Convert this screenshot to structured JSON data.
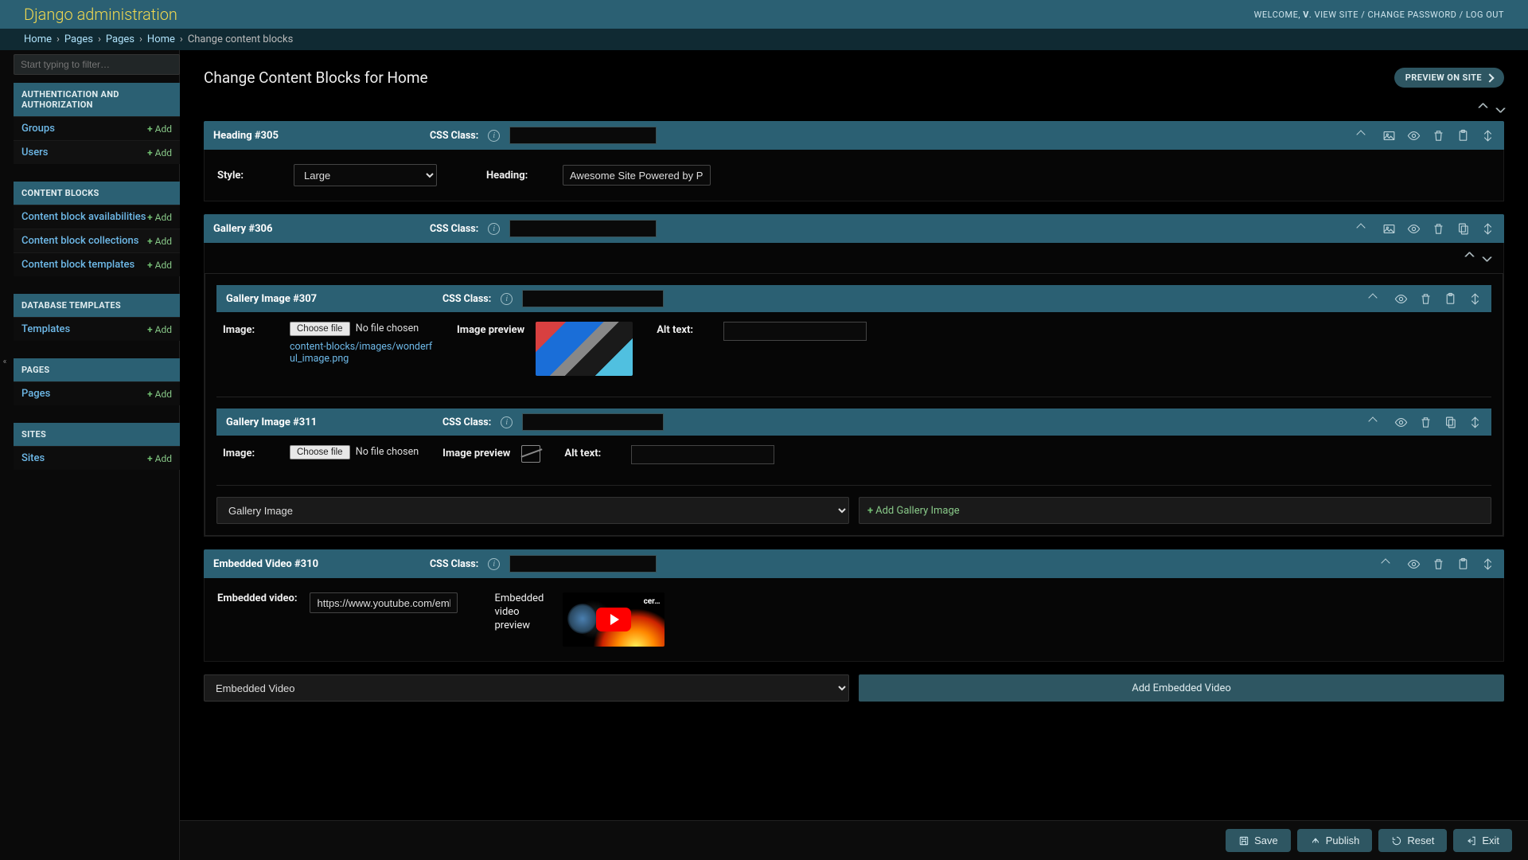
{
  "header": {
    "title": "Django administration",
    "welcome": "WELCOME, ",
    "user": "V",
    "view_site": "VIEW SITE",
    "change_password": "CHANGE PASSWORD",
    "log_out": "LOG OUT"
  },
  "breadcrumbs": {
    "items": [
      "Home",
      "Pages",
      "Pages",
      "Home"
    ],
    "current": "Change content blocks"
  },
  "sidebar": {
    "filter_placeholder": "Start typing to filter…",
    "sections": [
      {
        "title": "AUTHENTICATION AND AUTHORIZATION",
        "items": [
          {
            "label": "Groups",
            "add": "Add"
          },
          {
            "label": "Users",
            "add": "Add"
          }
        ]
      },
      {
        "title": "CONTENT BLOCKS",
        "items": [
          {
            "label": "Content block availabilities",
            "add": "Add"
          },
          {
            "label": "Content block collections",
            "add": "Add"
          },
          {
            "label": "Content block templates",
            "add": "Add"
          }
        ]
      },
      {
        "title": "DATABASE TEMPLATES",
        "items": [
          {
            "label": "Templates",
            "add": "Add"
          }
        ]
      },
      {
        "title": "PAGES",
        "items": [
          {
            "label": "Pages",
            "add": "Add"
          }
        ]
      },
      {
        "title": "SITES",
        "items": [
          {
            "label": "Sites",
            "add": "Add"
          }
        ]
      }
    ]
  },
  "page": {
    "title": "Change Content Blocks for Home",
    "preview_label": "PREVIEW ON SITE"
  },
  "labels": {
    "css_class": "CSS Class:",
    "style": "Style:",
    "heading": "Heading:",
    "image": "Image:",
    "image_preview": "Image preview",
    "alt_text": "Alt text:",
    "choose_file": "Choose file",
    "no_file": "No file chosen",
    "embedded_video": "Embedded video:",
    "video_preview": "Embedded video preview"
  },
  "blocks": {
    "heading": {
      "title": "Heading #305",
      "style_value": "Large",
      "heading_value": "Awesome Site Powered by Ponies"
    },
    "gallery": {
      "title": "Gallery #306",
      "images": [
        {
          "title": "Gallery Image #307",
          "file_link": "content-blocks/images/wonderful_image.png",
          "has_image": true
        },
        {
          "title": "Gallery Image #311",
          "file_link": "",
          "has_image": false
        }
      ],
      "add_select": "Gallery Image",
      "add_label": "Add Gallery Image"
    },
    "video": {
      "title": "Embedded Video #310",
      "url": "https://www.youtube.com/embed/RJlSF",
      "overlay_text": "cer…"
    },
    "outer_add_select": "Embedded Video",
    "outer_add_label": "Add Embedded Video"
  },
  "submit": {
    "save": "Save",
    "publish": "Publish",
    "reset": "Reset",
    "exit": "Exit"
  }
}
